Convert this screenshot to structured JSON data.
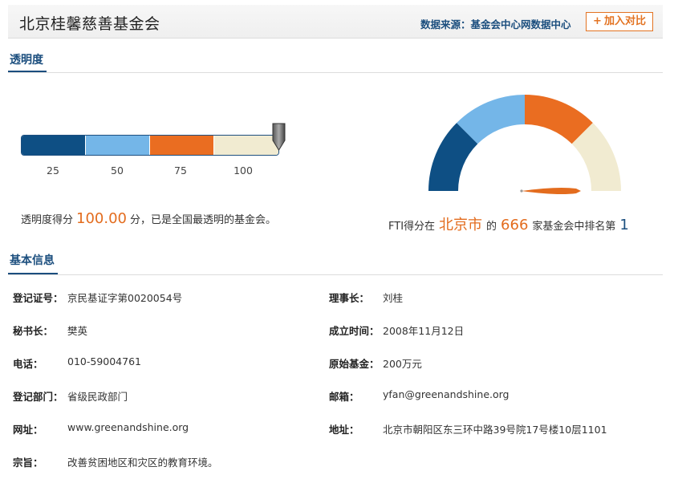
{
  "header": {
    "org_name": "北京桂馨慈善基金会",
    "source": "数据来源：基金会中心网数据中心",
    "compare_label": "加入对比"
  },
  "transparency": {
    "section_title": "透明度",
    "scale_segments": [
      {
        "color": "#0e4f84"
      },
      {
        "color": "#74b6e8"
      },
      {
        "color": "#ea6d21"
      },
      {
        "color": "#f1ebd1"
      }
    ],
    "ticks": [
      "25",
      "50",
      "75",
      "100"
    ],
    "score_fraction": 1.0,
    "score_prefix": "透明度得分",
    "score_value": "100.00",
    "score_suffix": "分，已是全国最透明的基金会。",
    "gauge_colors": [
      "#0e4f84",
      "#74b6e8",
      "#ea6d21",
      "#f1ebd1"
    ],
    "needle_color": "#e36c1e",
    "rank_prefix": "FTI得分在",
    "rank_city": "北京市",
    "rank_mid": "的",
    "rank_total": "666",
    "rank_mid2": "家基金会中排名第",
    "rank_value": "1"
  },
  "basic_info": {
    "section_title": "基本信息",
    "rows": [
      {
        "left_label": "登记证号：",
        "left_value": "京民基证字第0020054号",
        "right_label": "理事长：",
        "right_value": "刘桂"
      },
      {
        "left_label": "秘书长：",
        "left_value": "樊英",
        "right_label": "成立时间：",
        "right_value": "2008年11月12日"
      },
      {
        "left_label": "电话：",
        "left_value": "010-59004761",
        "right_label": "原始基金：",
        "right_value": "200万元"
      },
      {
        "left_label": "登记部门：",
        "left_value": "省级民政部门",
        "right_label": "邮箱：",
        "right_value": "yfan@greenandshine.org"
      },
      {
        "left_label": "网址：",
        "left_value": "www.greenandshine.org",
        "right_label": "地址：",
        "right_value": "北京市朝阳区东三环中路39号院17号楼10层1101"
      },
      {
        "left_label": "宗旨：",
        "left_value": "改善贫困地区和灾区的教育环境。"
      }
    ]
  }
}
